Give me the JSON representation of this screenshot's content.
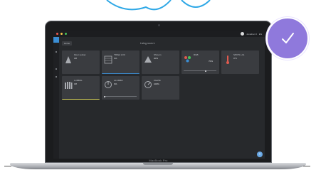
{
  "device": {
    "model_label": "MacBook Pro"
  },
  "app": {
    "window_dots": [
      "#f05a4f",
      "#f4c248",
      "#47c25a"
    ],
    "user_name": "Jonathan ▾",
    "top_right_text": "EN"
  },
  "header": {
    "back_label": "Home",
    "page_title": "Living room ▾"
  },
  "tiles": [
    {
      "name": "Floor socket",
      "value": "Off",
      "status": "",
      "icon": "plug-icon",
      "accent": ""
    },
    {
      "name": "TRIGA LOC",
      "value": "1%",
      "status": "",
      "icon": "shutter-icon",
      "accent": "#3b8ed4"
    },
    {
      "name": "Shroom",
      "value": "20%",
      "status": "",
      "icon": "lamp-icon",
      "accent": ""
    },
    {
      "name": "RGB",
      "value": "70%",
      "status": "",
      "icon": "color-dots-icon",
      "accent": ""
    },
    {
      "name": "SPOTL LIG",
      "value": "0°C",
      "status": "",
      "icon": "thermometer-icon",
      "accent": "#e05a4e"
    },
    {
      "name": "LUBBOL",
      "value": "Off",
      "status": "",
      "icon": "radiator-icon",
      "accent": "#d7d35a"
    },
    {
      "name": "ALUMBO",
      "value": "0%",
      "status": "",
      "icon": "dimmer-icon",
      "accent": ""
    },
    {
      "name": "ZGATE",
      "value": "100%",
      "status": "",
      "icon": "dimmer-icon",
      "accent": ""
    }
  ],
  "fab": {
    "label": "+"
  },
  "badge": {
    "icon": "checkmark-icon",
    "color": "#8f79dc"
  }
}
